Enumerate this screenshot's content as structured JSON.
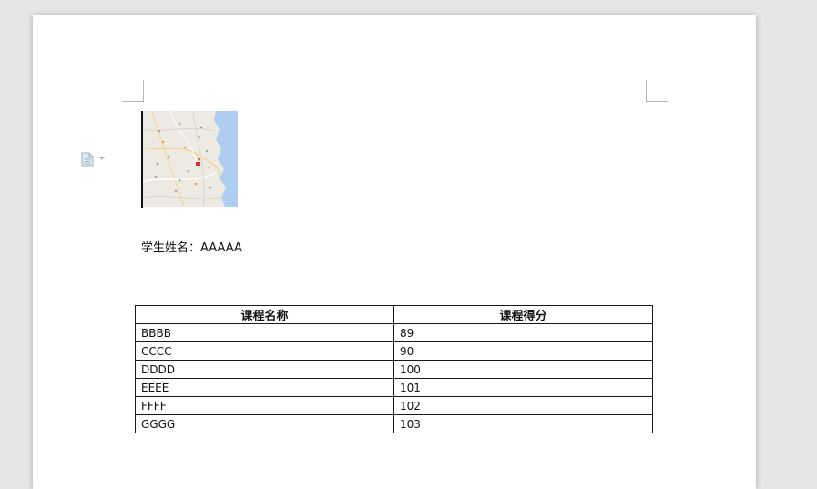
{
  "document": {
    "student_label": "学生姓名：",
    "student_name": "AAAAA"
  },
  "table": {
    "headers": [
      "课程名称",
      "课程得分"
    ],
    "rows": [
      {
        "course": "BBBB",
        "score": "89"
      },
      {
        "course": "CCCC",
        "score": "90"
      },
      {
        "course": "DDDD",
        "score": "100"
      },
      {
        "course": "EEEE",
        "score": "101"
      },
      {
        "course": "FFFF",
        "score": "102"
      },
      {
        "course": "GGGG",
        "score": "103"
      }
    ]
  },
  "icons": {
    "margin_tool": "document-icon",
    "margin_tool_caret": "caret-down-icon"
  },
  "colors": {
    "workspace": "#e6e6e6",
    "page": "#ffffff",
    "icon_accent": "#9fb6c9",
    "map_water": "#aecdf0"
  }
}
